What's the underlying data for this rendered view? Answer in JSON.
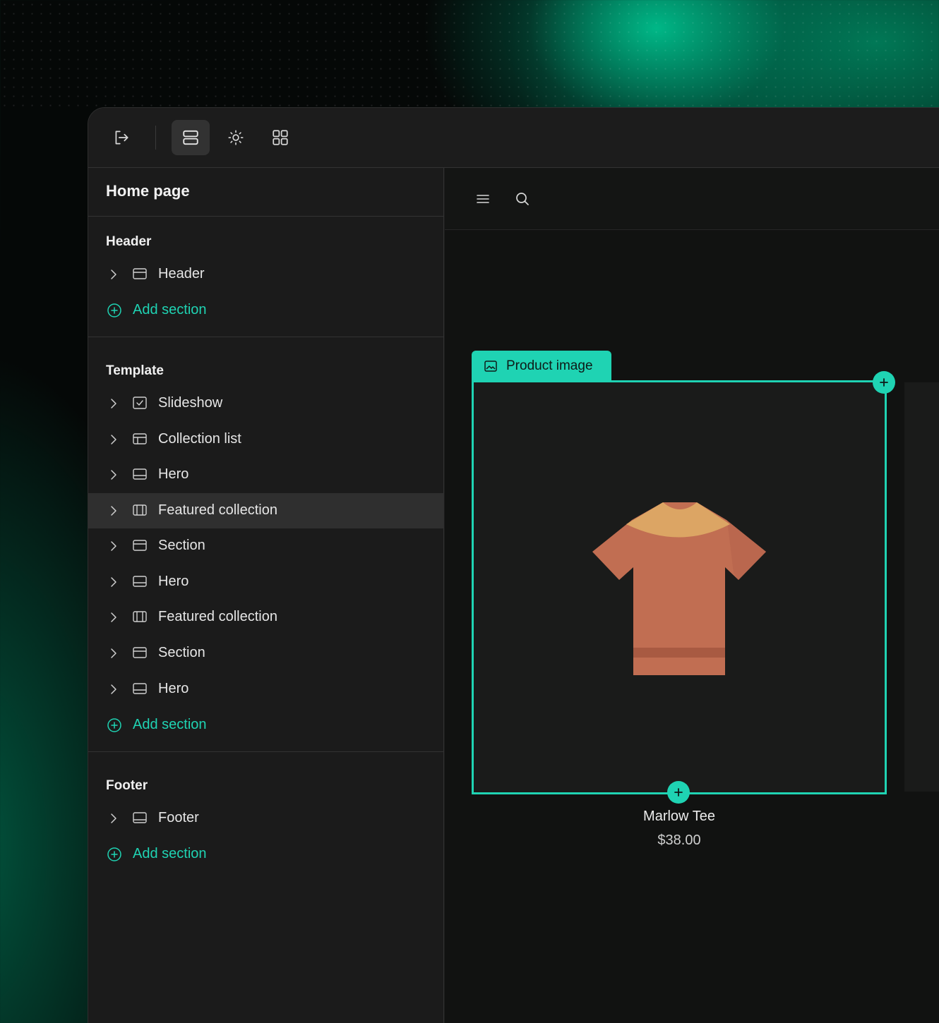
{
  "toolbar": {
    "buttons": [
      {
        "icon": "exit-icon"
      },
      {
        "icon": "sections-icon",
        "active": true
      },
      {
        "icon": "theme-settings-icon"
      },
      {
        "icon": "apps-grid-icon"
      }
    ]
  },
  "sidebar": {
    "title": "Home page",
    "groups": {
      "header": {
        "title": "Header",
        "items": [
          {
            "label": "Header",
            "icon": "header-section-icon"
          }
        ],
        "add_label": "Add section"
      },
      "template": {
        "title": "Template",
        "items": [
          {
            "label": "Slideshow",
            "icon": "slideshow-icon"
          },
          {
            "label": "Collection list",
            "icon": "collection-list-icon"
          },
          {
            "label": "Hero",
            "icon": "hero-icon"
          },
          {
            "label": "Featured collection",
            "icon": "featured-collection-icon",
            "selected": true
          },
          {
            "label": "Section",
            "icon": "section-icon"
          },
          {
            "label": "Hero",
            "icon": "hero-icon"
          },
          {
            "label": "Featured collection",
            "icon": "featured-collection-icon"
          },
          {
            "label": "Section",
            "icon": "section-icon"
          },
          {
            "label": "Hero",
            "icon": "hero-icon"
          }
        ],
        "add_label": "Add section"
      },
      "footer": {
        "title": "Footer",
        "items": [
          {
            "label": "Footer",
            "icon": "footer-section-icon"
          }
        ],
        "add_label": "Add section"
      }
    }
  },
  "preview": {
    "block_tag": "Product image",
    "product": {
      "name": "Marlow Tee",
      "price": "$38.00"
    }
  },
  "colors": {
    "accent": "#1fd3b3",
    "panel": "#1b1b1b",
    "preview_bg": "#111211",
    "tee_body": "#c16e52",
    "tee_collar": "#dca564"
  }
}
